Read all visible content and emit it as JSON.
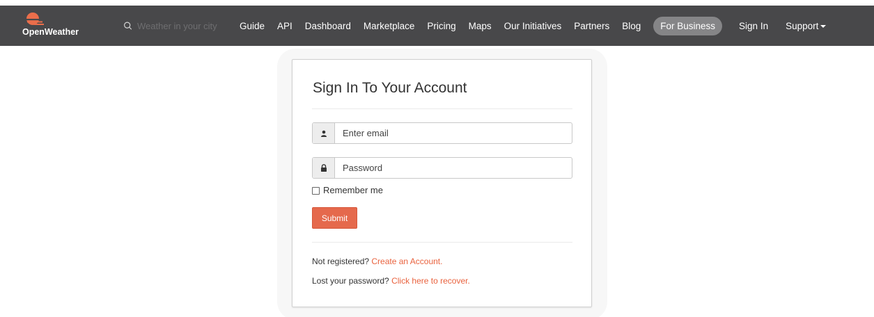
{
  "colors": {
    "navbar_bg": "#48484a",
    "accent": "#e5694c",
    "link": "#e9623e",
    "pill_bg": "#858587"
  },
  "brand": {
    "name": "OpenWeather",
    "logo_icon": "sun-cloud-logo-icon"
  },
  "search": {
    "placeholder": "Weather in your city",
    "icon": "search-icon"
  },
  "nav": {
    "items": [
      {
        "label": "Guide"
      },
      {
        "label": "API"
      },
      {
        "label": "Dashboard"
      },
      {
        "label": "Marketplace"
      },
      {
        "label": "Pricing"
      },
      {
        "label": "Maps"
      },
      {
        "label": "Our Initiatives"
      },
      {
        "label": "Partners"
      },
      {
        "label": "Blog"
      },
      {
        "label": "For Business"
      },
      {
        "label": "Sign In"
      },
      {
        "label": "Support"
      }
    ]
  },
  "signin": {
    "title": "Sign In To Your Account",
    "email_placeholder": "Enter email",
    "email_icon": "user-icon",
    "password_placeholder": "Password",
    "password_icon": "lock-icon",
    "remember_label": "Remember me",
    "remember_checked": false,
    "submit_label": "Submit",
    "not_registered_text": "Not registered?",
    "create_account_link": "Create an Account.",
    "lost_password_text": "Lost your password?",
    "recover_link": "Click here to recover."
  }
}
